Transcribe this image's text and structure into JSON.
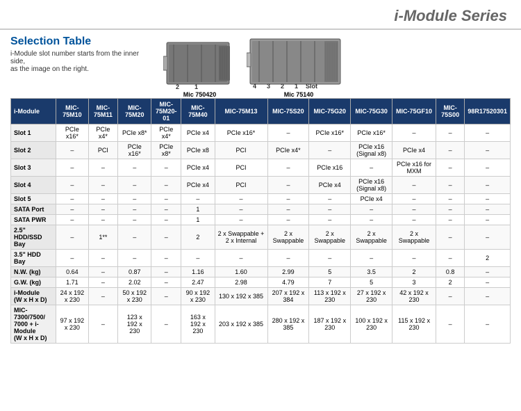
{
  "header": {
    "title": "i-Module Series"
  },
  "section": {
    "title": "Selection Table",
    "desc_line1": "i-Module slot number starts from the inner side,",
    "desc_line2": "as the image on the right."
  },
  "devices": [
    {
      "name": "Mic 750420",
      "slots": "2 1"
    },
    {
      "name": "Mic 75140",
      "slots": "4 3 2 1  Slot"
    }
  ],
  "table": {
    "headers": [
      "i-Module",
      "MIC-75M10",
      "MIC-75M11",
      "MIC-75M20",
      "MIC-75M20-01",
      "MIC-75M40",
      "MIC-75M13",
      "MIC-75S20",
      "MIC-75G20",
      "MIC-75G30",
      "MIC-75GF10",
      "MIC-75S00",
      "98R17520301"
    ],
    "rows": [
      {
        "label": "Slot 1",
        "values": [
          "PCIe x16*",
          "PCIe x4*",
          "PCIe x8*",
          "PCIe x4*",
          "PCIe x4",
          "PCIe x16*",
          "–",
          "PCIe x16*",
          "PCIe x16*",
          "–",
          "–",
          "–"
        ]
      },
      {
        "label": "Slot 2",
        "values": [
          "–",
          "PCI",
          "PCIe x16*",
          "PCIe x8*",
          "PCIe x8",
          "PCI",
          "PCIe x4*",
          "–",
          "PCIe x16 (Signal x8)",
          "PCIe x4",
          "–",
          "–"
        ]
      },
      {
        "label": "Slot 3",
        "values": [
          "–",
          "–",
          "–",
          "–",
          "PCIe x4",
          "PCI",
          "–",
          "PCIe x16",
          "–",
          "PCIe x16 for MXM",
          "–",
          "–"
        ]
      },
      {
        "label": "Slot 4",
        "values": [
          "–",
          "–",
          "–",
          "–",
          "PCIe x4",
          "PCI",
          "–",
          "PCIe x4",
          "PCIe x16 (Signal x8)",
          "–",
          "–",
          "–"
        ]
      },
      {
        "label": "Slot 5",
        "values": [
          "–",
          "–",
          "–",
          "–",
          "–",
          "–",
          "–",
          "–",
          "PCIe x4",
          "–",
          "–",
          "–"
        ]
      },
      {
        "label": "SATA Port",
        "values": [
          "–",
          "–",
          "–",
          "–",
          "1",
          "–",
          "–",
          "–",
          "–",
          "–",
          "–",
          "–"
        ]
      },
      {
        "label": "SATA PWR",
        "values": [
          "–",
          "–",
          "–",
          "–",
          "1",
          "–",
          "–",
          "–",
          "–",
          "–",
          "–",
          "–"
        ]
      },
      {
        "label": "2.5\" HDD/SSD Bay",
        "values": [
          "–",
          "1**",
          "–",
          "–",
          "2",
          "2 x Swappable + 2 x Internal",
          "2 x Swappable",
          "2 x Swappable",
          "2 x Swappable",
          "2 x Swappable",
          "–",
          "–"
        ]
      },
      {
        "label": "3.5\" HDD Bay",
        "values": [
          "–",
          "–",
          "–",
          "–",
          "–",
          "–",
          "–",
          "–",
          "–",
          "–",
          "–",
          "2"
        ]
      },
      {
        "label": "N.W. (kg)",
        "values": [
          "0.64",
          "–",
          "0.87",
          "–",
          "1.16",
          "1.60",
          "2.99",
          "5",
          "3.5",
          "2",
          "0.8"
        ]
      },
      {
        "label": "G.W. (kg)",
        "values": [
          "1.71",
          "–",
          "2.02",
          "–",
          "2.47",
          "2.98",
          "4.79",
          "7",
          "5",
          "3",
          "2"
        ]
      },
      {
        "label": "i-Module (W x H x D)",
        "values": [
          "24 x 192 x 230",
          "–",
          "50 x 192 x 230",
          "–",
          "90 x 192 x 230",
          "130 x 192 x 385",
          "207 x 192 x 384",
          "113 x 192 x 230",
          "27 x 192 x 230",
          "42 x 192 x 230"
        ]
      },
      {
        "label": "MIC-7300/7500/7000 + i-Module (W x H x D)",
        "values": [
          "97 x 192 x 230",
          "–",
          "123 x 192 x 230",
          "–",
          "163 x 192 x 230",
          "203 x 192 x 385",
          "280 x 192 x 385",
          "187 x 192 x 230",
          "100 x 192 x 230",
          "115 x 192 x 230"
        ]
      }
    ]
  }
}
